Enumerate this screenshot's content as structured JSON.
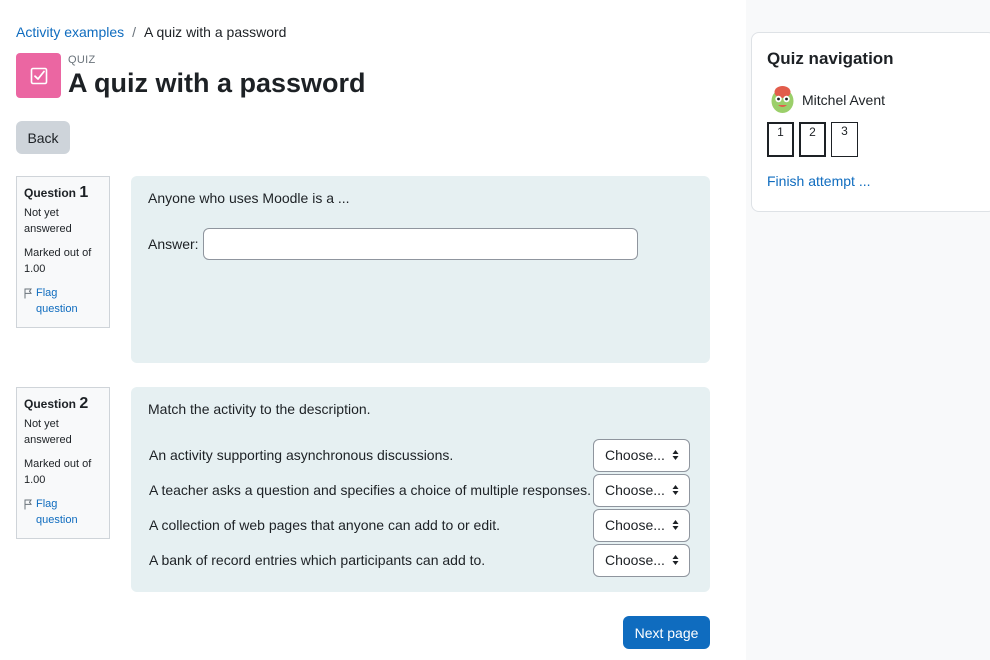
{
  "breadcrumb": {
    "parent": "Activity examples",
    "separator": "/",
    "current": "A quiz with a password"
  },
  "header": {
    "kind": "QUIZ",
    "title": "A quiz with a password",
    "icon_color": "#eb66a2"
  },
  "back_label": "Back",
  "questions": [
    {
      "label": "Question",
      "number": "1",
      "state": "Not yet answered",
      "grade": "Marked out of 1.00",
      "flag": "Flag question",
      "text": "Anyone who uses Moodle is a ...",
      "answer_label": "Answer:",
      "answer_value": ""
    },
    {
      "label": "Question",
      "number": "2",
      "state": "Not yet answered",
      "grade": "Marked out of 1.00",
      "flag": "Flag question",
      "text": "Match the activity to the description.",
      "stems": [
        {
          "text": "An activity supporting asynchronous discussions.",
          "selected": "Choose..."
        },
        {
          "text": "A teacher asks a question and specifies a choice of multiple responses.",
          "selected": "Choose..."
        },
        {
          "text": "A collection of web pages that anyone can add to or edit.",
          "selected": "Choose..."
        },
        {
          "text": "A bank of record entries which participants can add to.",
          "selected": "Choose..."
        }
      ]
    }
  ],
  "next_label": "Next page",
  "navigation": {
    "title": "Quiz navigation",
    "user_name": "Mitchel Avent",
    "question_buttons": [
      "1",
      "2",
      "3"
    ],
    "finish_label": "Finish attempt ..."
  },
  "colors": {
    "primary": "#0f6cbf",
    "question_bg": "#e6f0f2",
    "quiz_icon": "#eb66a2"
  }
}
